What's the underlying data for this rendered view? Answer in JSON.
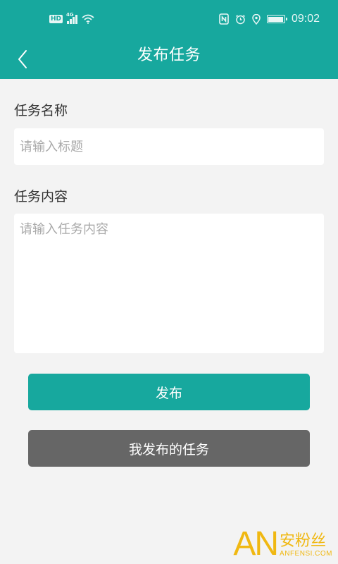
{
  "status_bar": {
    "hd_label": "HD",
    "network_label": "4G",
    "time": "09:02",
    "icons": [
      "hd-icon",
      "signal-icon",
      "wifi-icon",
      "nfc-icon",
      "alarm-icon",
      "location-icon",
      "battery-icon"
    ]
  },
  "header": {
    "title": "发布任务",
    "back_icon": "chevron-left-icon"
  },
  "form": {
    "task_name_label": "任务名称",
    "task_name_placeholder": "请输入标题",
    "task_name_value": "",
    "task_content_label": "任务内容",
    "task_content_placeholder": "请输入任务内容",
    "task_content_value": ""
  },
  "actions": {
    "publish_label": "发布",
    "my_tasks_label": "我发布的任务"
  },
  "watermark": {
    "logo": "AN",
    "cn": "安粉丝",
    "en": "ANFENSI.COM"
  },
  "colors": {
    "primary": "#17a89e",
    "secondary_button": "#666666",
    "background": "#f3f3f3",
    "watermark": "#f0b400"
  }
}
